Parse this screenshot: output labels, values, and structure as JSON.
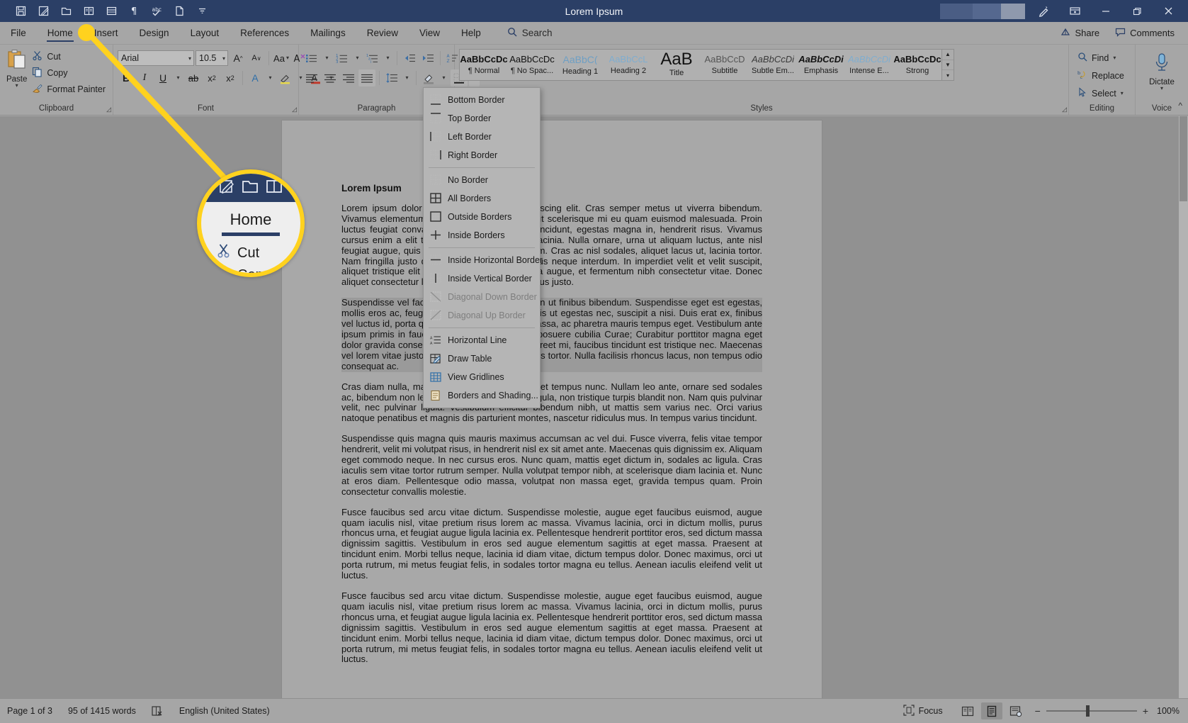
{
  "titlebar": {
    "document_title": "Lorem Ipsum",
    "qat": [
      {
        "name": "save-icon",
        "label": "Save"
      },
      {
        "name": "autosave-icon",
        "label": "AutoSave"
      },
      {
        "name": "open-folder-icon",
        "label": "Open"
      },
      {
        "name": "read-mode-icon",
        "label": "Read Mode"
      },
      {
        "name": "print-layout-icon",
        "label": "Print Layout"
      },
      {
        "name": "paragraph-mark-icon",
        "label": "Show Formatting"
      },
      {
        "name": "spelling-check-icon",
        "label": "Spelling & Grammar"
      },
      {
        "name": "new-document-icon",
        "label": "New"
      },
      {
        "name": "customize-qat-icon",
        "label": "Customize Quick Access Toolbar"
      }
    ],
    "window_buttons": [
      {
        "name": "pen-icon",
        "label": "Ink"
      },
      {
        "name": "ribbon-display-options-icon",
        "label": "Ribbon Display Options"
      },
      {
        "name": "minimize-button",
        "label": "Minimize"
      },
      {
        "name": "restore-button",
        "label": "Restore Down"
      },
      {
        "name": "close-button",
        "label": "Close"
      }
    ]
  },
  "tabs": [
    {
      "label": "File",
      "active": false
    },
    {
      "label": "Home",
      "active": true
    },
    {
      "label": "Insert",
      "active": false
    },
    {
      "label": "Design",
      "active": false
    },
    {
      "label": "Layout",
      "active": false
    },
    {
      "label": "References",
      "active": false
    },
    {
      "label": "Mailings",
      "active": false
    },
    {
      "label": "Review",
      "active": false
    },
    {
      "label": "View",
      "active": false
    },
    {
      "label": "Help",
      "active": false
    }
  ],
  "search": {
    "label": "Search",
    "placeholder": "Search"
  },
  "tabbar_right": {
    "share": "Share",
    "comments": "Comments"
  },
  "ribbon": {
    "groups": [
      {
        "label": "Clipboard"
      },
      {
        "label": "Font"
      },
      {
        "label": "Paragraph"
      },
      {
        "label": "Styles"
      },
      {
        "label": "Editing"
      },
      {
        "label": "Voice"
      }
    ],
    "clipboard": {
      "paste": "Paste",
      "cut": "Cut",
      "copy": "Copy",
      "format_painter": "Format Painter"
    },
    "font": {
      "font_name": "Arial",
      "font_size": "10.5",
      "grow_font": "A",
      "shrink_font": "A",
      "change_case": "Aa",
      "clear_formatting": "A",
      "bold": "B",
      "italic": "I",
      "underline": "U",
      "strikethrough": "ab",
      "subscript": "x",
      "superscript": "x",
      "text_effects": "A",
      "text_highlight": "A",
      "font_color": "A"
    },
    "paragraph": {
      "bullets": "Bullets",
      "numbering": "Numbering",
      "multilevel_list": "Multilevel List",
      "decrease_indent": "Decrease Indent",
      "increase_indent": "Increase Indent",
      "sort": "Sort",
      "show_marks": "Show/Hide",
      "align_left": "Align Left",
      "align_center": "Center",
      "align_right": "Align Right",
      "justify": "Justify",
      "line_spacing": "Line and Paragraph Spacing",
      "shading": "Shading",
      "borders": "Borders"
    },
    "styles": [
      {
        "preview": "AaBbCcDc",
        "name": "¶ Normal"
      },
      {
        "preview": "AaBbCcDc",
        "name": "¶ No Spac..."
      },
      {
        "preview": "AaBbC(",
        "name": "Heading 1"
      },
      {
        "preview": "AaBbCcL",
        "name": "Heading 2"
      },
      {
        "preview": "AaB",
        "name": "Title"
      },
      {
        "preview": "AaBbCcD",
        "name": "Subtitle"
      },
      {
        "preview": "AaBbCcDi",
        "name": "Subtle Em..."
      },
      {
        "preview": "AaBbCcDi",
        "name": "Emphasis"
      },
      {
        "preview": "AaBbCcDi",
        "name": "Intense E..."
      },
      {
        "preview": "AaBbCcDc",
        "name": "Strong"
      }
    ],
    "editing": {
      "find": "Find",
      "replace": "Replace",
      "select": "Select"
    },
    "voice": {
      "dictate": "Dictate"
    }
  },
  "borders_menu": {
    "items": [
      {
        "label": "Bottom Border",
        "accel": "B",
        "icon": "bottom-border-icon",
        "disabled": false
      },
      {
        "label": "Top Border",
        "accel": "p",
        "icon": "top-border-icon",
        "disabled": false
      },
      {
        "label": "Left Border",
        "accel": "L",
        "icon": "left-border-icon",
        "disabled": false
      },
      {
        "label": "Right Border",
        "accel": "R",
        "icon": "right-border-icon",
        "disabled": false
      },
      {
        "separator": true
      },
      {
        "label": "No Border",
        "accel": "N",
        "icon": "no-border-icon",
        "disabled": false
      },
      {
        "label": "All Borders",
        "accel": "A",
        "icon": "all-borders-icon",
        "disabled": false
      },
      {
        "label": "Outside Borders",
        "accel": "s",
        "icon": "outside-borders-icon",
        "disabled": false
      },
      {
        "label": "Inside Borders",
        "accel": "I",
        "icon": "inside-borders-icon",
        "disabled": false
      },
      {
        "separator": true
      },
      {
        "label": "Inside Horizontal Border",
        "accel": "H",
        "icon": "inside-horizontal-border-icon",
        "disabled": false
      },
      {
        "label": "Inside Vertical Border",
        "accel": "V",
        "icon": "inside-vertical-border-icon",
        "disabled": false
      },
      {
        "label": "Diagonal Down Border",
        "accel": "w",
        "icon": "diagonal-down-border-icon",
        "disabled": true
      },
      {
        "label": "Diagonal Up Border",
        "accel": "U",
        "icon": "diagonal-up-border-icon",
        "disabled": true
      },
      {
        "separator": true
      },
      {
        "label": "Horizontal Line",
        "accel": "z",
        "icon": "horizontal-line-icon",
        "disabled": false
      },
      {
        "label": "Draw Table",
        "accel": "D",
        "icon": "draw-table-icon",
        "disabled": false
      },
      {
        "label": "View Gridlines",
        "accel": "G",
        "icon": "view-gridlines-icon",
        "disabled": false
      },
      {
        "label": "Borders and Shading...",
        "accel": "o",
        "icon": "borders-and-shading-icon",
        "disabled": false
      }
    ]
  },
  "callout": {
    "tab_label": "Home",
    "cut_label": "Cut",
    "copy_label": "Copy",
    "highlight_color": "#ffd21e"
  },
  "document": {
    "heading": "Lorem Ipsum",
    "paragraphs": [
      {
        "selected": false,
        "text": "Lorem ipsum dolor sit amet, consectetur adipiscing elit. Cras semper metus ut viverra bibendum. Vivamus elementum ante sed eros venenatis, ut scelerisque mi eu quam euismod malesuada. Proin luctus feugiat convallis. Nunc vel erat at est tincidunt, egestas magna in, hendrerit risus. Vivamus cursus enim a elit tempor, vel vehicula quam lacinia. Nulla ornare, urna ut aliquam luctus, ante nisl feugiat augue, quis tempus odio lorem sed lorem. Cras ac nisl sodales, aliquet lacus ut, lacinia tortor. Nam fringilla justo quis leo laoreet, quis faucibus neque interdum. In imperdiet velit et velit suscipit, aliquet tristique elit tincidunt. Nunc ultricies urna augue, et fermentum nibh consectetur vitae. Donec aliquet consectetur lorem, id euismod diam tempus justo."
      },
      {
        "selected": true,
        "text": "Suspendisse vel facilisis arcu. Nulla facilisi. Proin ut finibus bibendum. Suspendisse eget est egestas, mollis eros ac, feugiat ligula. Nullam eget facilisis ut egestas nec, suscipit a nisi. Duis erat ex, finibus vel luctus id, porta quis lectus. Integer viverra massa, ac pharetra mauris tempus eget. Vestibulum ante ipsum primis in faucibus orci luctus et ultrices posuere cubilia Curae; Curabitur porttitor magna eget dolor gravida consectetur. Duis pellentesque laoreet mi, faucibus tincidunt est tristique nec. Maecenas vel lorem vitae justo et quam quis, aliquet lobortis tortor. Nulla facilisis rhoncus lacus, non tempus odio consequat ac."
      },
      {
        "selected": false,
        "text": "Cras diam nulla, malesuada vitae mi id, imperdiet tempus nunc. Nullam leo ante, ornare sed sodales ac, bibendum non leo. Etiam volutpat vehicula ligula, non tristique turpis blandit non. Nam quis pulvinar velit, nec pulvinar ligula. Vestibulum efficitur bibendum nibh, ut mattis sem varius nec. Orci varius natoque penatibus et magnis dis parturient montes, nascetur ridiculus mus. In tempus varius tincidunt."
      },
      {
        "selected": false,
        "text": "Suspendisse quis magna quis mauris maximus accumsan ac vel dui. Fusce viverra, felis vitae tempor hendrerit, velit mi volutpat risus, in hendrerit nisl ex sit amet ante. Maecenas quis dignissim ex. Aliquam eget commodo neque. In nec cursus eros. Nunc quam, mattis eget dictum in, sodales ac ligula. Cras iaculis sem vitae tortor rutrum semper. Nulla volutpat tempor nibh, at scelerisque diam lacinia et. Nunc at eros diam. Pellentesque odio massa, volutpat non massa eget, gravida tempus quam. Proin consectetur convallis molestie."
      },
      {
        "selected": false,
        "text": "Fusce faucibus sed arcu vitae dictum. Suspendisse molestie, augue eget faucibus euismod, augue quam iaculis nisl, vitae pretium risus lorem ac massa. Vivamus lacinia, orci in dictum mollis, purus rhoncus urna, et feugiat augue ligula lacinia ex. Pellentesque hendrerit porttitor eros, sed dictum massa dignissim sagittis. Vestibulum in eros sed augue elementum sagittis at eget massa. Praesent at tincidunt enim. Morbi tellus neque, lacinia id diam vitae, dictum tempus dolor. Donec maximus, orci ut porta rutrum, mi metus feugiat felis, in sodales tortor magna eu tellus. Aenean iaculis eleifend velit ut luctus."
      },
      {
        "selected": false,
        "text": "Fusce faucibus sed arcu vitae dictum. Suspendisse molestie, augue eget faucibus euismod, augue quam iaculis nisl, vitae pretium risus lorem ac massa. Vivamus lacinia, orci in dictum mollis, purus rhoncus urna, et feugiat augue ligula lacinia ex. Pellentesque hendrerit porttitor eros, sed dictum massa dignissim sagittis. Vestibulum in eros sed augue elementum sagittis at eget massa. Praesent at tincidunt enim. Morbi tellus neque, lacinia id diam vitae, dictum tempus dolor. Donec maximus, orci ut porta rutrum, mi metus feugiat felis, in sodales tortor magna eu tellus. Aenean iaculis eleifend velit ut luctus."
      }
    ]
  },
  "statusbar": {
    "page": "Page 1 of 3",
    "words": "95 of 1415 words",
    "proofing_icon": "proofing-errors-icon",
    "language": "English (United States)",
    "focus": "Focus",
    "views": [
      {
        "name": "read-mode-view",
        "active": false
      },
      {
        "name": "print-layout-view",
        "active": true
      },
      {
        "name": "web-layout-view",
        "active": false
      }
    ],
    "zoom_out": "−",
    "zoom_in": "+",
    "zoom_level": "100%"
  },
  "theme": {
    "titlebar_bg": "#2b3f66",
    "ribbon_bg": "#a6a6a6",
    "accent": "#2b3f66",
    "highlight": "#ffd21e",
    "menu_bg": "#b5b5b5"
  }
}
